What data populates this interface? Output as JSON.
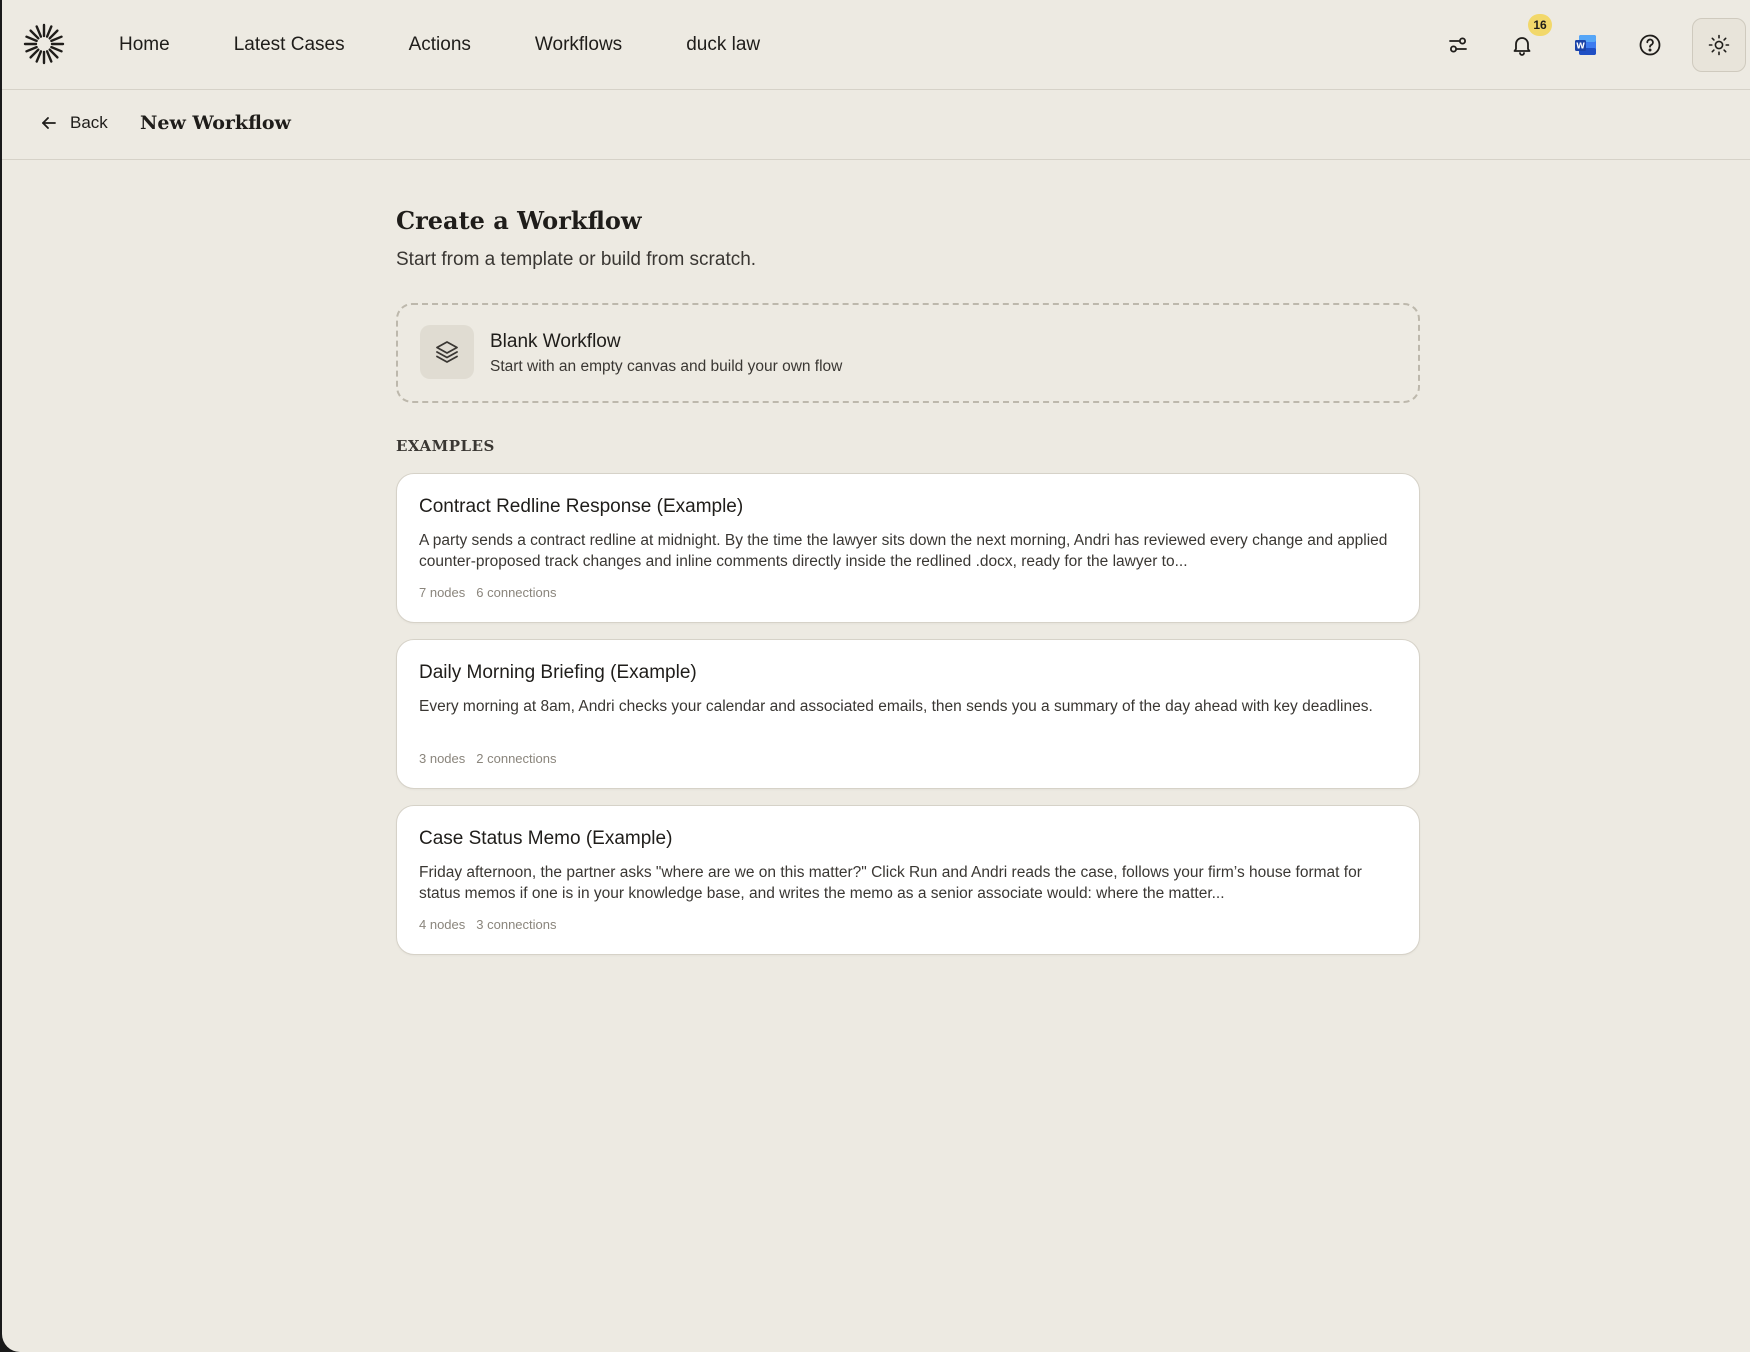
{
  "nav": {
    "items": [
      {
        "label": "Home"
      },
      {
        "label": "Latest Cases"
      },
      {
        "label": "Actions"
      },
      {
        "label": "Workflows"
      },
      {
        "label": "duck law"
      }
    ],
    "notification_count": "16",
    "icons": [
      "sliders-icon",
      "bell-icon",
      "word-app-icon",
      "help-icon",
      "sun-icon"
    ],
    "badge_color": "#f2d86a"
  },
  "subheader": {
    "back_label": "Back",
    "title": "New Workflow"
  },
  "main": {
    "title": "Create a Workflow",
    "subtitle": "Start from a template or build from scratch.",
    "blank": {
      "title": "Blank Workflow",
      "description": "Start with an empty canvas and build your own flow"
    },
    "examples_label": "EXAMPLES",
    "examples": [
      {
        "title": "Contract Redline Response (Example)",
        "description": "A party sends a contract redline at midnight. By the time the lawyer sits down the next morning, Andri has reviewed every change and applied counter-proposed track changes and inline comments directly inside the redlined .docx, ready for the lawyer to...",
        "nodes": "7 nodes",
        "connections": "6 connections"
      },
      {
        "title": "Daily Morning Briefing (Example)",
        "description": "Every morning at 8am, Andri checks your calendar and associated emails, then sends you a summary of the day ahead with key deadlines.",
        "nodes": "3 nodes",
        "connections": "2 connections"
      },
      {
        "title": "Case Status Memo (Example)",
        "description": "Friday afternoon, the partner asks \"where are we on this matter?\" Click Run and Andri reads the case, follows your firm’s house format for status memos if one is in your knowledge base, and writes the memo as a senior associate would: where the matter...",
        "nodes": "4 nodes",
        "connections": "3 connections"
      }
    ]
  },
  "colors": {
    "background": "#edeae2",
    "card": "#ffffff",
    "text": "#1f1d1a"
  }
}
